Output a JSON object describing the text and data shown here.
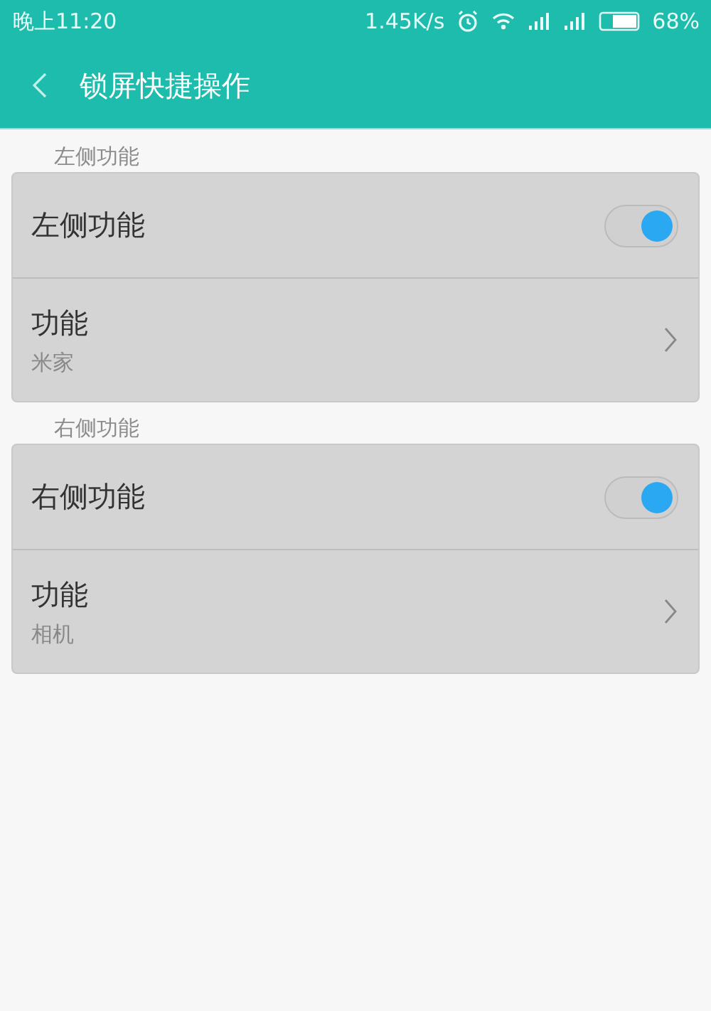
{
  "status_bar": {
    "time": "晚上11:20",
    "speed": "1.45K/s",
    "battery": "68%"
  },
  "header": {
    "title": "锁屏快捷操作"
  },
  "sections": [
    {
      "title": "左侧功能",
      "rows": [
        {
          "kind": "toggle",
          "label": "左侧功能",
          "on": true
        },
        {
          "kind": "link",
          "label": "功能",
          "value": "米家"
        }
      ]
    },
    {
      "title": "右侧功能",
      "rows": [
        {
          "kind": "toggle",
          "label": "右侧功能",
          "on": true
        },
        {
          "kind": "link",
          "label": "功能",
          "value": "相机"
        }
      ]
    }
  ]
}
